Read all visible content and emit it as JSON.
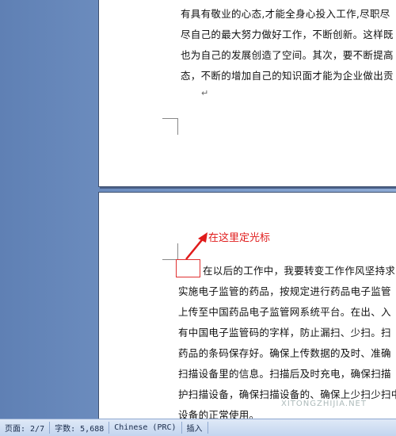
{
  "document": {
    "page_top_lines": [
      "有具有敬业的心态,才能全身心投入工作,尽职尽",
      "尽自己的最大努力做好工作，不断创新。这样既",
      "也为自己的发展创造了空间。其次，要不断提高",
      "态，不断的增加自己的知识面才能为企业做出贡"
    ],
    "paragraph_mark": "↵",
    "page_bottom_lines": [
      "在以后的工作中，我要转变工作作风坚持求",
      "实施电子监管的药品，按规定进行药品电子监管",
      "上传至中国药品电子监管网系统平台。在出、入",
      "有中国电子监管码的字样，防止漏扫、少扫。扫",
      "药品的条码保存好。确保上传数据的及时、准确",
      "扫描设备里的信息。扫描后及时充电，确保扫描",
      "护扫描设备，确保扫描设备的、确保上少扫少扫中",
      "设备的正常使用。"
    ]
  },
  "annotation": {
    "label": "在这里定光标",
    "color": "#e01b1b"
  },
  "statusbar": {
    "page": "页面: 2/7",
    "words": "字数: 5,688",
    "language": "Chinese (PRC)",
    "mode": "插入"
  },
  "watermark": "XITONGZHIJIA.NET"
}
